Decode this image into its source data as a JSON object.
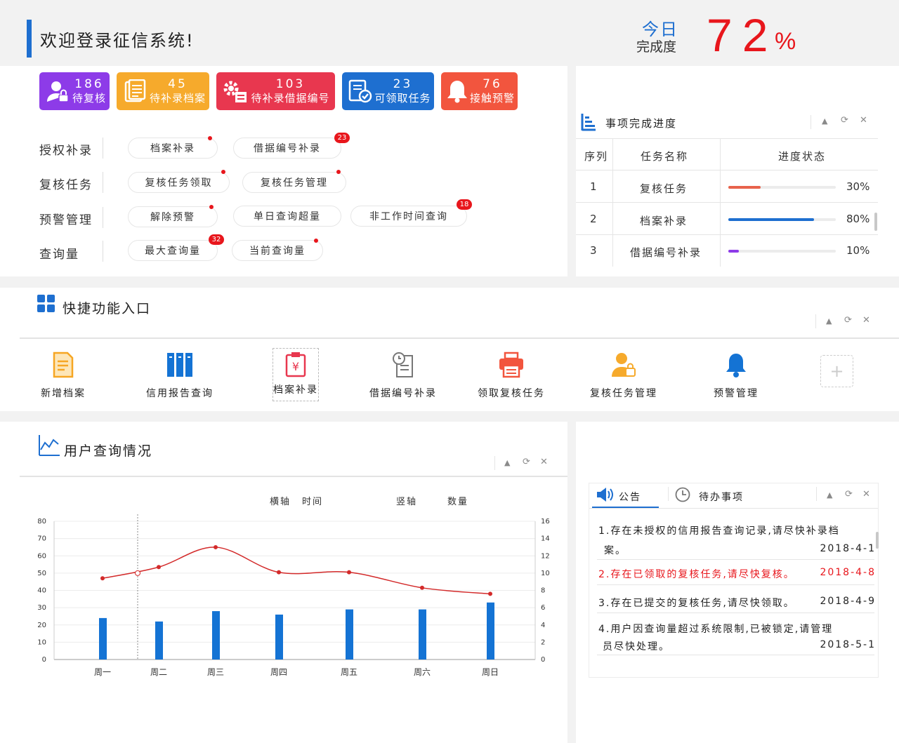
{
  "header": {
    "welcome": "欢迎登录征信系统!",
    "today_label": "今日",
    "completion_label": "完成度",
    "completion_value": "72",
    "completion_unit": "%"
  },
  "colors": {
    "accent": "#1e6fd0",
    "danger": "#e8161c",
    "purple": "#8d3be8",
    "orange": "#f6aa2c",
    "red": "#e8374f",
    "blue": "#1e6fd0",
    "alarm": "#f2553e"
  },
  "stats": [
    {
      "value": "186",
      "label": "待复核",
      "icon": "user-lock-icon"
    },
    {
      "value": "45",
      "label": "待补录档案",
      "icon": "document-icon"
    },
    {
      "value": "103",
      "label": "待补录借据编号",
      "icon": "gear-list-icon"
    },
    {
      "value": "23",
      "label": "可领取任务",
      "icon": "checklist-icon"
    },
    {
      "value": "76",
      "label": "接触预警",
      "icon": "bell-icon"
    }
  ],
  "categories": [
    {
      "label": "授权补录",
      "items": [
        {
          "label": "档案补录",
          "dot": true
        },
        {
          "label": "借据编号补录",
          "badge": "23"
        }
      ]
    },
    {
      "label": "复核任务",
      "items": [
        {
          "label": "复核任务领取",
          "dot": true
        },
        {
          "label": "复核任务管理",
          "dot": true
        }
      ]
    },
    {
      "label": "预警管理",
      "items": [
        {
          "label": "解除预警",
          "dot": true
        },
        {
          "label": "单日查询超量"
        },
        {
          "label": "非工作时间查询",
          "badge": "18"
        }
      ]
    },
    {
      "label": "查询量",
      "items": [
        {
          "label": "最大查询量",
          "badge": "32"
        },
        {
          "label": "当前查询量",
          "dot": true
        }
      ]
    }
  ],
  "progress_panel": {
    "title": "事项完成进度",
    "headers": [
      "序列",
      "任务名称",
      "进度状态"
    ],
    "rows": [
      {
        "index": "1",
        "name": "复核任务",
        "percent_text": "30%",
        "percent": 30,
        "color": "#e8634c"
      },
      {
        "index": "2",
        "name": "档案补录",
        "percent_text": "80%",
        "percent": 80,
        "color": "#1e6fd0"
      },
      {
        "index": "3",
        "name": "借据编号补录",
        "percent_text": "10%",
        "percent": 10,
        "color": "#8d3be8"
      }
    ]
  },
  "controls": {
    "collapse": "▲",
    "refresh": "⟳",
    "close": "✕"
  },
  "quick": {
    "title": "快捷功能入口",
    "items": [
      {
        "label": "新增档案",
        "icon": "new-file-icon"
      },
      {
        "label": "信用报告查询",
        "icon": "books-icon"
      },
      {
        "label": "档案补录",
        "icon": "clipboard-yuan-icon"
      },
      {
        "label": "借据编号补录",
        "icon": "clock-document-icon"
      },
      {
        "label": "领取复核任务",
        "icon": "printer-icon"
      },
      {
        "label": "复核任务管理",
        "icon": "user-lock-icon"
      },
      {
        "label": "预警管理",
        "icon": "bell-icon"
      }
    ],
    "add_symbol": "+"
  },
  "chart_panel": {
    "title": "用户查询情况",
    "x_axis_label": "横轴",
    "x_axis_value": "时间",
    "y_axis_label": "竖轴",
    "y_axis_value": "数量"
  },
  "chart_data": {
    "type": "bar",
    "categories": [
      "周一",
      "周二",
      "周三",
      "周四",
      "周五",
      "周六",
      "周日"
    ],
    "series": [
      {
        "type": "bar",
        "axis": "left",
        "values": [
          24,
          22,
          28,
          26,
          29,
          29,
          33
        ],
        "color": "#1473d4"
      },
      {
        "type": "line",
        "axis": "right",
        "values": [
          9.4,
          10.7,
          13,
          10.1,
          10.1,
          8.3,
          7.6
        ],
        "color": "#d32a2a"
      }
    ],
    "ylim_left": [
      0,
      80
    ],
    "yticks_left": [
      0,
      10,
      20,
      30,
      40,
      50,
      60,
      70,
      80
    ],
    "ylim_right": [
      0,
      16
    ],
    "yticks_right": [
      0,
      2,
      4,
      6,
      8,
      10,
      12,
      14,
      16
    ],
    "grid": true
  },
  "notice_panel": {
    "tab_notice": "公告",
    "tab_todo": "待办事项",
    "notices": [
      {
        "text": "1.存在未授权的信用报告查询记录,请尽快补录档",
        "text2": "案。",
        "date": "2018-4-1",
        "highlight": false
      },
      {
        "text": "2.存在已领取的复核任务,请尽快复核。",
        "date": "2018-4-8",
        "highlight": true
      },
      {
        "text": "3.存在已提交的复核任务,请尽快领取。",
        "date": "2018-4-9",
        "highlight": false
      },
      {
        "text": "4.用户因查询量超过系统限制,已被锁定,请管理",
        "text2": "员尽快处理。",
        "date": "2018-5-1",
        "highlight": false
      }
    ]
  }
}
